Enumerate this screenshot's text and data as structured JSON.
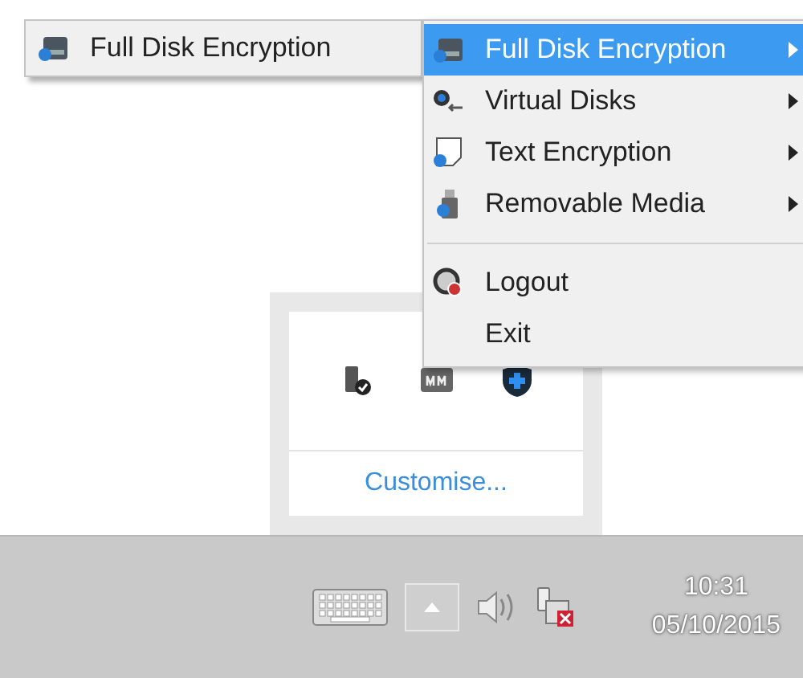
{
  "submenu": {
    "items": [
      {
        "kind": "disk",
        "label": "Full Disk Encryption"
      }
    ]
  },
  "menu": {
    "items": [
      {
        "kind": "disk",
        "label": "Full Disk Encryption",
        "selected": true,
        "has_submenu": true
      },
      {
        "kind": "virtual",
        "label": "Virtual Disks",
        "selected": false,
        "has_submenu": true
      },
      {
        "kind": "text",
        "label": "Text Encryption",
        "selected": false,
        "has_submenu": true
      },
      {
        "kind": "media",
        "label": "Removable Media",
        "selected": false,
        "has_submenu": true
      },
      {
        "kind": "separator"
      },
      {
        "kind": "logout",
        "label": "Logout",
        "selected": false,
        "has_submenu": false
      },
      {
        "kind": "plain",
        "label": "Exit",
        "selected": false,
        "has_submenu": false
      }
    ]
  },
  "tray_overflow": {
    "link": "Customise..."
  },
  "taskbar": {
    "time": "10:31",
    "date": "05/10/2015"
  }
}
